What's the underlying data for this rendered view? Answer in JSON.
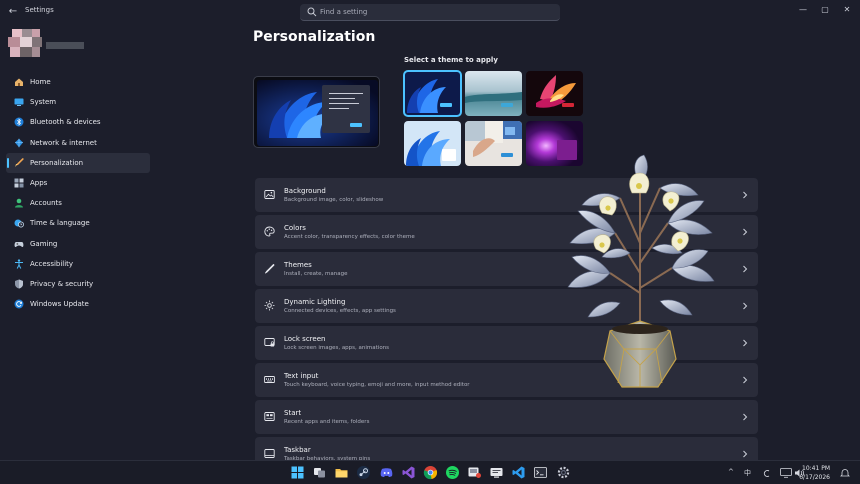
{
  "window": {
    "title": "Settings",
    "back": "←",
    "controls": {
      "minimize": "—",
      "maximize": "▢",
      "close": "✕"
    }
  },
  "search": {
    "placeholder": "Find a setting"
  },
  "sidebar": {
    "items": [
      {
        "label": "Home",
        "icon": "home-icon",
        "active": false
      },
      {
        "label": "System",
        "icon": "monitor-icon",
        "active": false
      },
      {
        "label": "Bluetooth & devices",
        "icon": "bluetooth-icon",
        "active": false
      },
      {
        "label": "Network & internet",
        "icon": "network-icon",
        "active": false
      },
      {
        "label": "Personalization",
        "icon": "brush-icon",
        "active": true
      },
      {
        "label": "Apps",
        "icon": "apps-icon",
        "active": false
      },
      {
        "label": "Accounts",
        "icon": "person-icon",
        "active": false
      },
      {
        "label": "Time & language",
        "icon": "clock-globe-icon",
        "active": false
      },
      {
        "label": "Gaming",
        "icon": "gamepad-icon",
        "active": false
      },
      {
        "label": "Accessibility",
        "icon": "accessibility-icon",
        "active": false
      },
      {
        "label": "Privacy & security",
        "icon": "shield-icon",
        "active": false
      },
      {
        "label": "Windows Update",
        "icon": "update-icon",
        "active": false
      }
    ]
  },
  "main": {
    "title": "Personalization",
    "theme_heading": "Select a theme to apply",
    "themes": [
      {
        "name": "windows-light-bloom",
        "selected": true
      },
      {
        "name": "glow",
        "selected": false
      },
      {
        "name": "flow",
        "selected": false
      },
      {
        "name": "windows-light",
        "selected": false
      },
      {
        "name": "captured-motion",
        "selected": false
      },
      {
        "name": "sunrise",
        "selected": false
      }
    ],
    "cards": [
      {
        "title": "Background",
        "subtitle": "Background image, color, slideshow",
        "icon": "image-icon"
      },
      {
        "title": "Colors",
        "subtitle": "Accent color, transparency effects, color theme",
        "icon": "palette-icon"
      },
      {
        "title": "Themes",
        "subtitle": "Install, create, manage",
        "icon": "pen-icon"
      },
      {
        "title": "Dynamic Lighting",
        "subtitle": "Connected devices, effects, app settings",
        "icon": "sparkle-icon"
      },
      {
        "title": "Lock screen",
        "subtitle": "Lock screen images, apps, animations",
        "icon": "lock-screen-icon"
      },
      {
        "title": "Text input",
        "subtitle": "Touch keyboard, voice typing, emoji and more, input method editor",
        "icon": "keyboard-icon"
      },
      {
        "title": "Start",
        "subtitle": "Recent apps and items, folders",
        "icon": "start-icon"
      },
      {
        "title": "Taskbar",
        "subtitle": "Taskbar behaviors, system pins",
        "icon": "taskbar-icon"
      }
    ]
  },
  "taskbar": {
    "tray": {
      "caret": "^",
      "ime": "中",
      "time": "10:41 PM",
      "date": "6/17/2026"
    }
  },
  "colors": {
    "accent": "#4cc2ff",
    "background": "#1c1e2b",
    "card": "#2a2c3a"
  }
}
